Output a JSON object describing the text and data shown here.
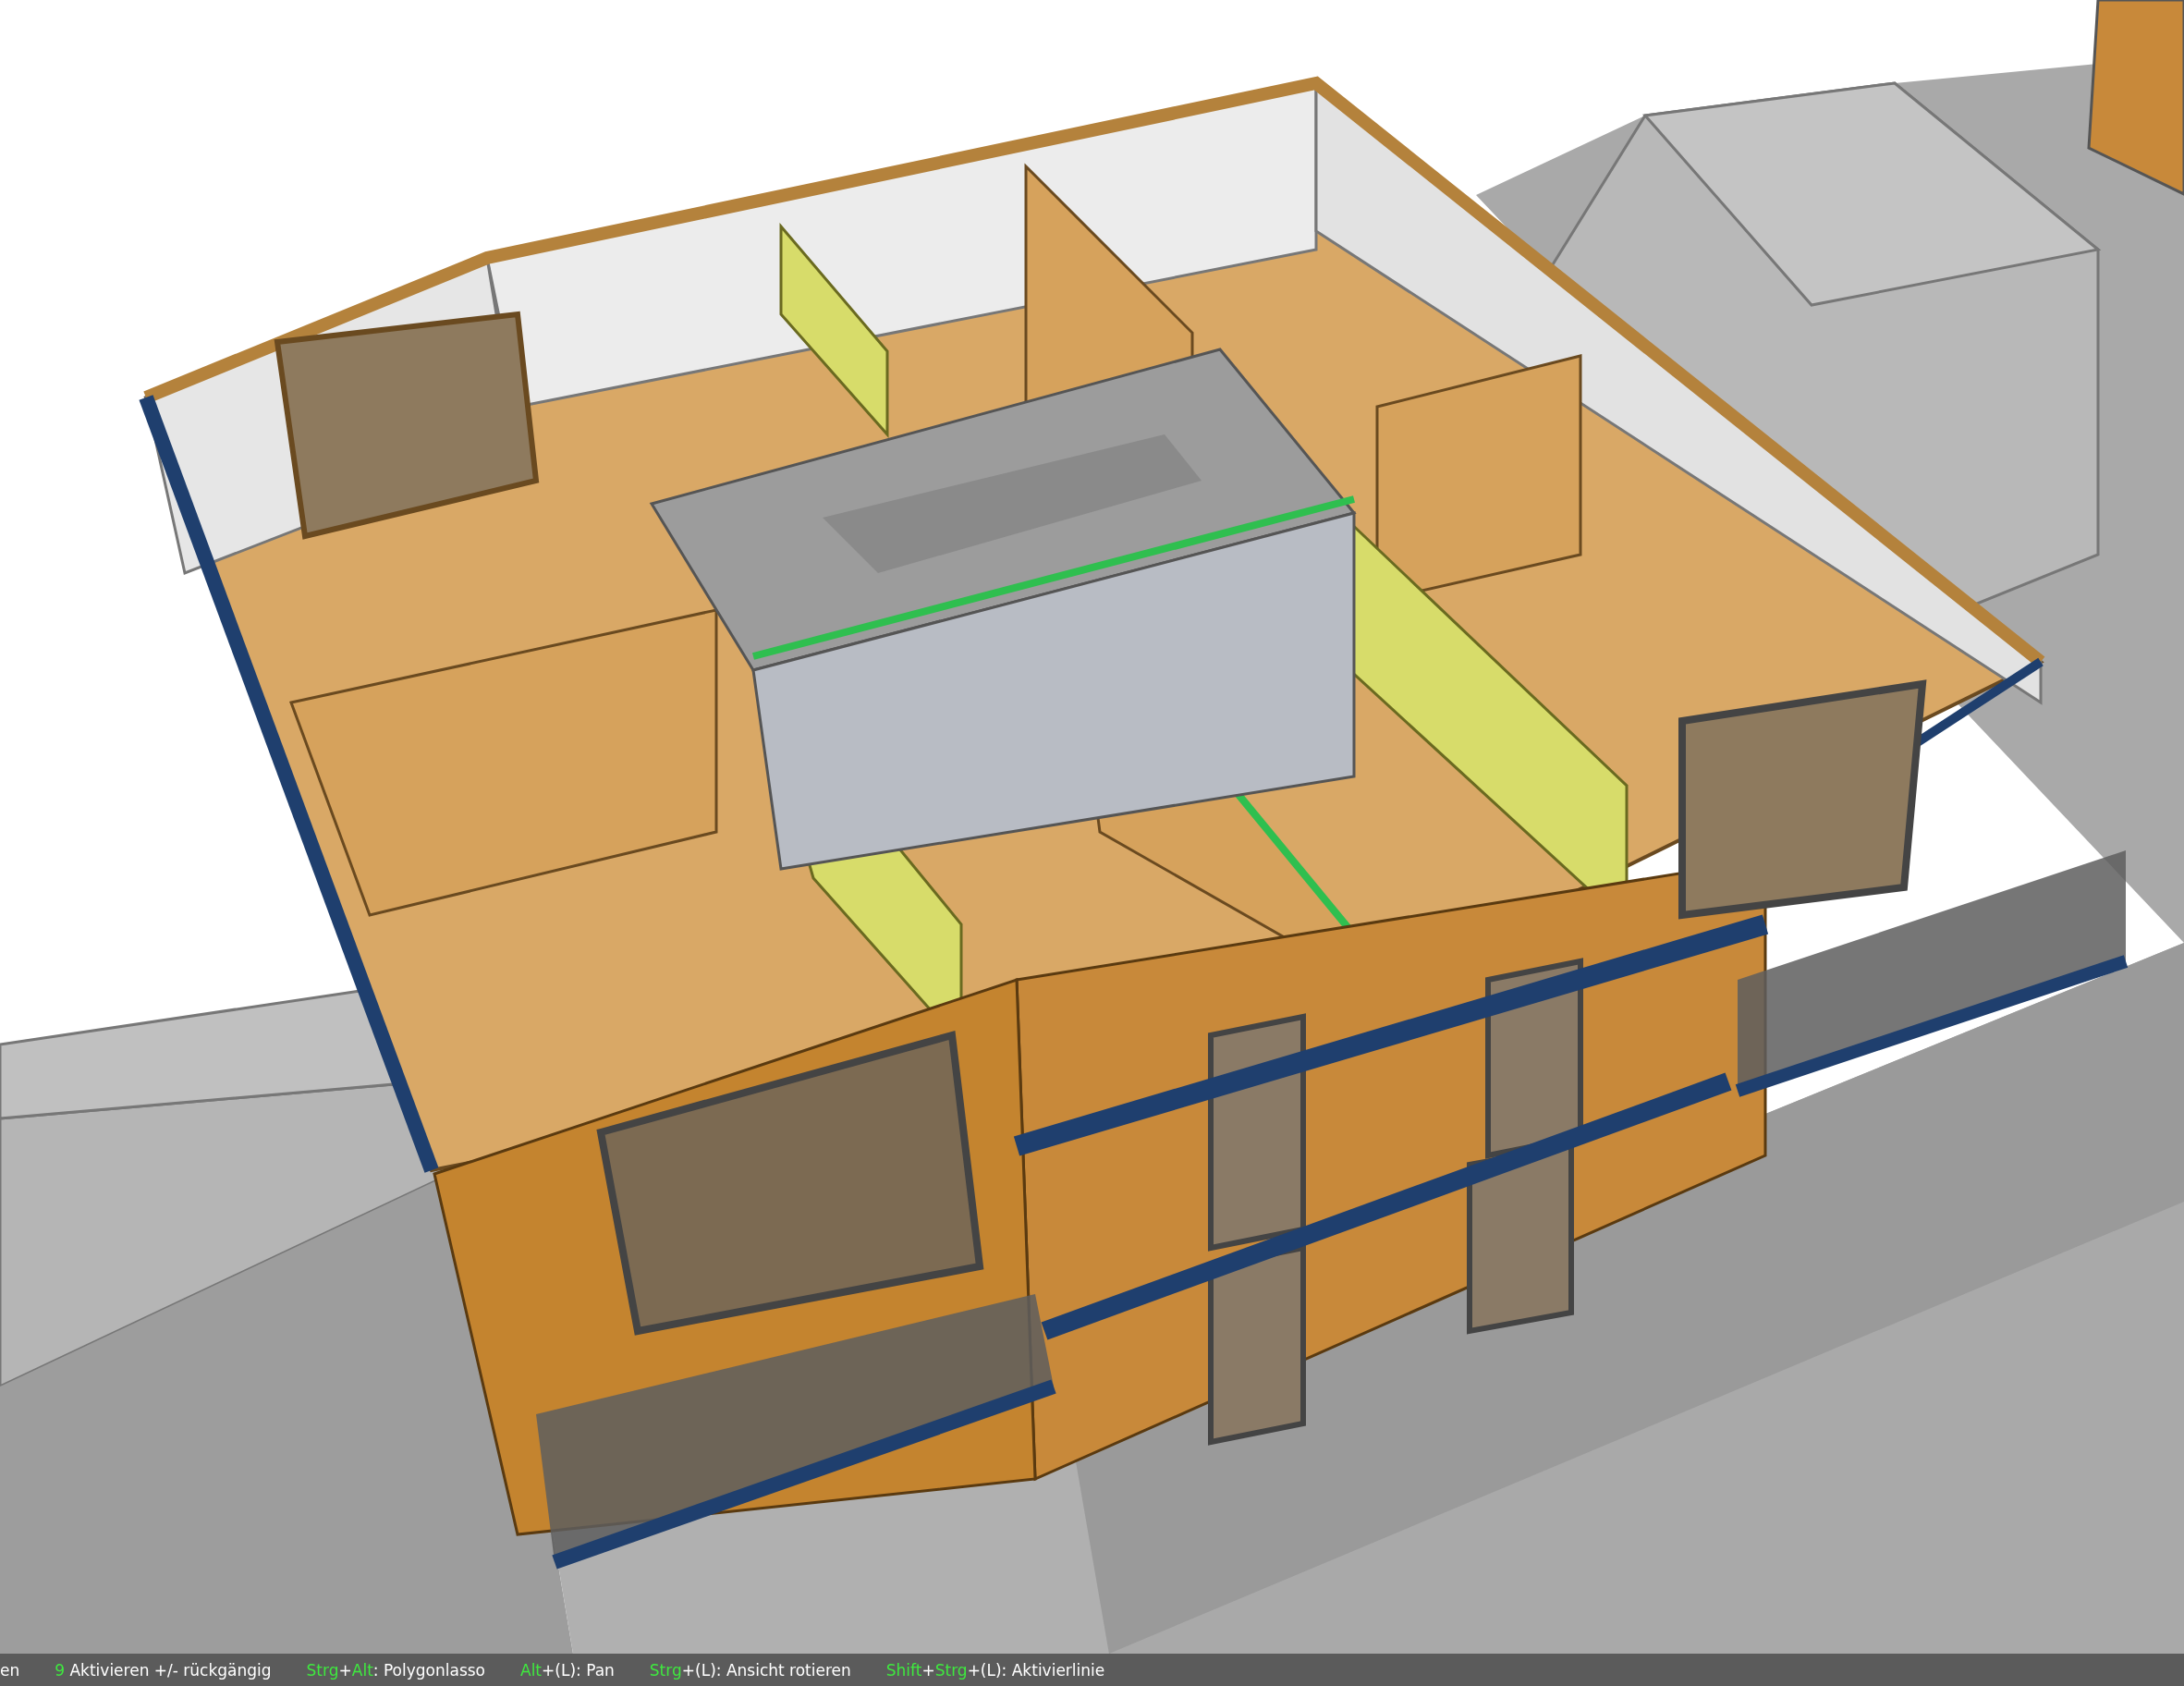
{
  "status_bar": {
    "hints": [
      {
        "parts": [
          {
            "kind": "plain",
            "text": "en"
          }
        ]
      },
      {
        "parts": [
          {
            "kind": "key",
            "text": "9"
          },
          {
            "kind": "plain",
            "text": " Aktivieren +/- rückgängig"
          }
        ]
      },
      {
        "parts": [
          {
            "kind": "key",
            "text": "Strg"
          },
          {
            "kind": "plain",
            "text": "+"
          },
          {
            "kind": "key",
            "text": "Alt"
          },
          {
            "kind": "plain",
            "text": ": Polygonlasso"
          }
        ]
      },
      {
        "parts": [
          {
            "kind": "key",
            "text": "Alt"
          },
          {
            "kind": "plain",
            "text": "+(L): Pan"
          }
        ]
      },
      {
        "parts": [
          {
            "kind": "key",
            "text": "Strg"
          },
          {
            "kind": "plain",
            "text": "+(L): Ansicht rotieren"
          }
        ]
      },
      {
        "parts": [
          {
            "kind": "key",
            "text": "Shift"
          },
          {
            "kind": "plain",
            "text": "+"
          },
          {
            "kind": "key",
            "text": "Strg"
          },
          {
            "kind": "plain",
            "text": "+(L): Aktivierlinie"
          }
        ]
      }
    ]
  }
}
